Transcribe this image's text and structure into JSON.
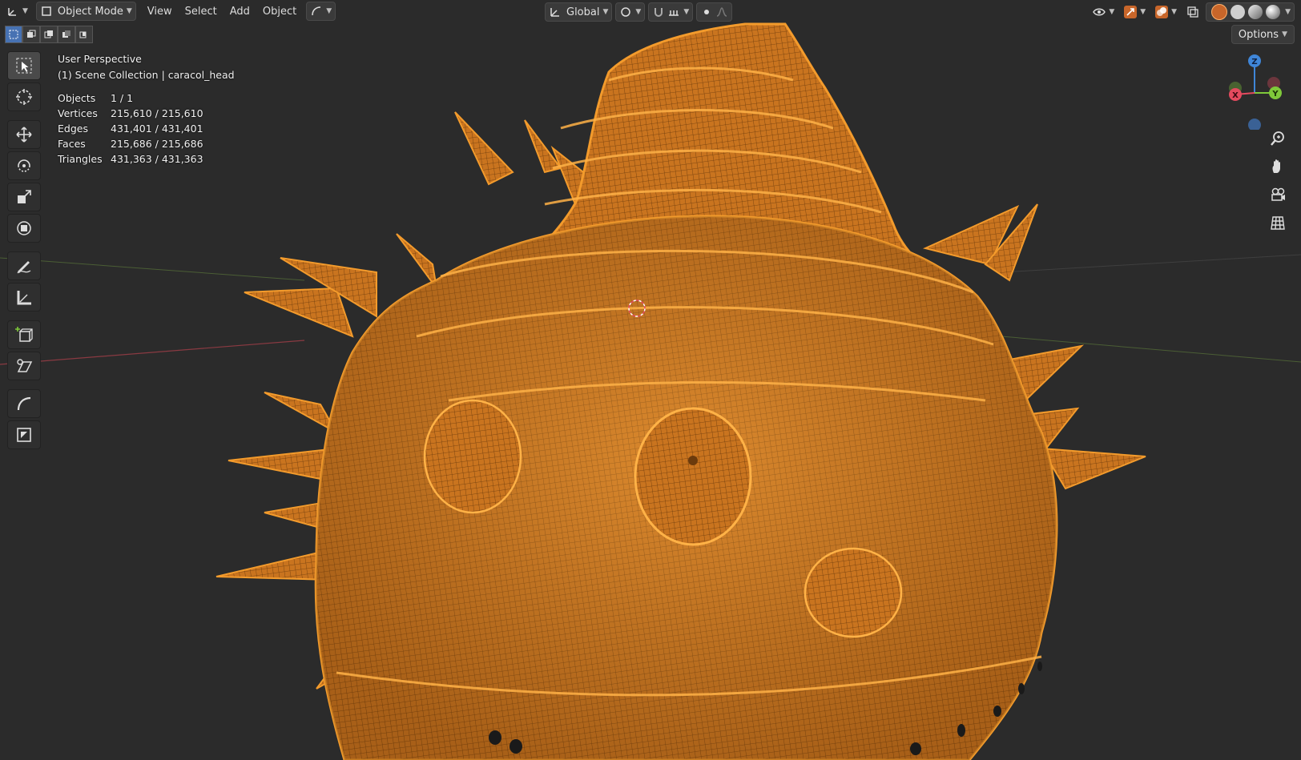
{
  "header": {
    "mode": "Object Mode",
    "menus": [
      "View",
      "Select",
      "Add",
      "Object"
    ],
    "transform_orientation": "Global"
  },
  "options_label": "Options",
  "overlay": {
    "view_name": "User Perspective",
    "collection_line": "(1) Scene Collection | caracol_head",
    "stats": [
      {
        "label": "Objects",
        "value": "1 / 1"
      },
      {
        "label": "Vertices",
        "value": "215,610 / 215,610"
      },
      {
        "label": "Edges",
        "value": "431,401 / 431,401"
      },
      {
        "label": "Faces",
        "value": "215,686 / 215,686"
      },
      {
        "label": "Triangles",
        "value": "431,363 / 431,363"
      }
    ]
  },
  "gizmo": {
    "x": "X",
    "y": "Y",
    "z": "Z"
  },
  "colors": {
    "viewport_bg": "#2b2b2b",
    "wire": "#f39b2c",
    "wire_dark": "#8a4a10",
    "selection_accent": "#4772b3",
    "axis_x": "#e44a5e",
    "axis_y": "#7fc93a",
    "axis_z": "#3f86d8"
  },
  "icons": {
    "editor_type": "editor-type-icon",
    "tools": [
      "select-box-icon",
      "cursor-icon",
      "move-icon",
      "rotate-icon",
      "scale-icon",
      "transform-icon",
      "annotate-icon",
      "measure-icon",
      "add-cube-icon",
      "shear-icon",
      "curve-icon",
      "inset-icon"
    ],
    "nav": [
      "zoom-icon",
      "hand-pan-icon",
      "camera-icon",
      "grid-ortho-icon"
    ]
  }
}
